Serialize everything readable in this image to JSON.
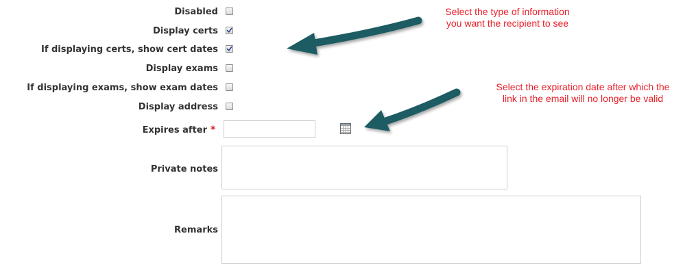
{
  "form": {
    "fields": {
      "disabled": {
        "label": "Disabled",
        "checked": false
      },
      "display_certs": {
        "label": "Display certs",
        "checked": true
      },
      "show_cert_dates": {
        "label": "If displaying certs, show cert dates",
        "checked": true
      },
      "display_exams": {
        "label": "Display exams",
        "checked": false
      },
      "show_exam_dates": {
        "label": "If displaying exams, show exam dates",
        "checked": false
      },
      "display_address": {
        "label": "Display address",
        "checked": false
      },
      "expires_after": {
        "label": "Expires after",
        "required_marker": "*",
        "value": ""
      },
      "private_notes": {
        "label": "Private notes",
        "value": ""
      },
      "remarks": {
        "label": "Remarks",
        "value": ""
      }
    }
  },
  "annotations": {
    "type_note": [
      "Select the type of information",
      "you want the recipient to see"
    ],
    "expiration_note": [
      "Select the expiration date after which the",
      "link in the email will no longer be valid"
    ]
  },
  "icons": {
    "calendar": "calendar-icon",
    "checkmark": "checkmark-icon",
    "resize": "resize-grip-icon"
  },
  "colors": {
    "annotation_text": "#e8202a",
    "arrow": "#1f5c62",
    "label_text": "#333333",
    "required_marker": "#dd1111"
  }
}
